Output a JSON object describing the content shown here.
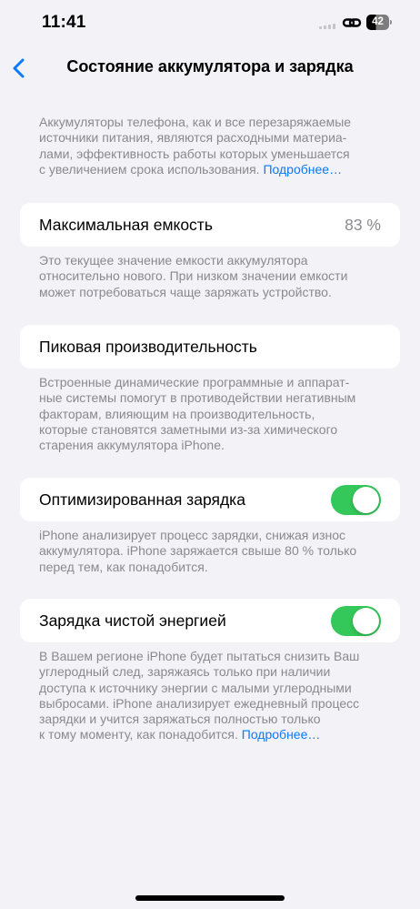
{
  "status_bar": {
    "time": "11:41",
    "battery_level": "42",
    "battery_level_fraction": 0.42
  },
  "nav": {
    "title": "Состояние аккумулятора и зарядка",
    "back_icon": "chevron-left-icon"
  },
  "intro": {
    "line1": "Аккумуляторы телефона, как и все перезаряжаемые",
    "line2": "источники питания, являются расходными материа-",
    "line3": "лами, эффективность работы которых уменьшается",
    "line4": "с увеличением срока использования.",
    "link": "Подробнее…"
  },
  "max_capacity": {
    "label": "Максимальная емкость",
    "value": "83 %",
    "note": {
      "line1": "Это текущее значение емкости аккумулятора",
      "line2": "относительно нового. При низком значении емкости",
      "line3": "может потребоваться чаще заряжать устройство."
    }
  },
  "peak_performance": {
    "label": "Пиковая производительность",
    "note": {
      "line1": "Встроенные динамические программные и аппарат-",
      "line2": "ные системы помогут в противодействии негативным",
      "line3": "факторам, влияющим на производительность,",
      "line4": "которые становятся заметными из-за химического",
      "line5": "старения аккумулятора iPhone."
    }
  },
  "optimized_charging": {
    "label": "Оптимизированная зарядка",
    "enabled": true,
    "note": {
      "line1": "iPhone анализирует процесс зарядки, снижая износ",
      "line2": "аккумулятора. iPhone заряжается свыше 80 % только",
      "line3": "перед тем, как понадобится."
    }
  },
  "clean_energy_charging": {
    "label": "Зарядка чистой энергией",
    "enabled": true,
    "note": {
      "line1": "В Вашем регионе iPhone будет пытаться снизить Ваш",
      "line2": "углеродный след, заряжаясь только при наличии",
      "line3": "доступа к источнику энергии с малыми углеродными",
      "line4": "выбросами. iPhone анализирует ежедневный процесс",
      "line5": "зарядки и учится заряжаться полностью только",
      "line6": "к тому моменту, как понадобится.",
      "link": "Подробнее…"
    }
  },
  "colors": {
    "accent": "#0a7aff",
    "toggle_on": "#34c759",
    "background": "#f2f2f7",
    "secondary_text": "#8a8a8e"
  }
}
